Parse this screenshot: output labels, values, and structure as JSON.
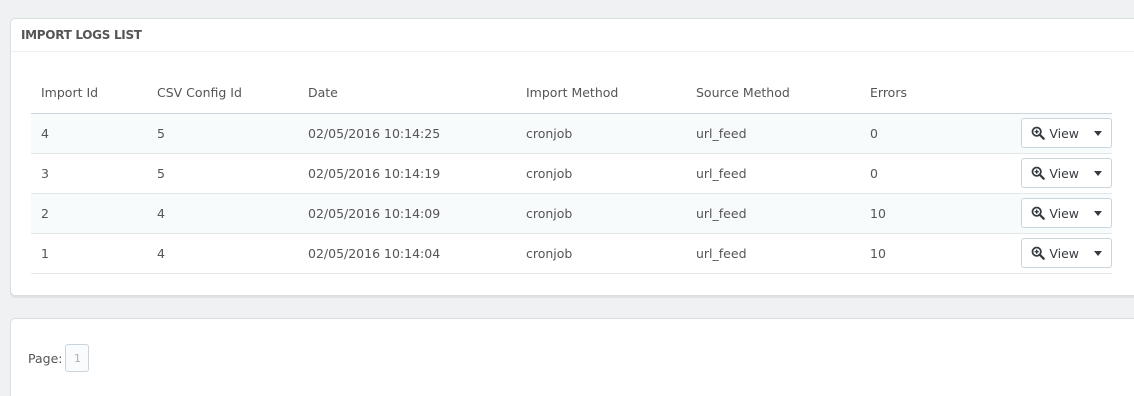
{
  "panel": {
    "title": "IMPORT LOGS LIST"
  },
  "table": {
    "headers": [
      "Import Id",
      "CSV Config Id",
      "Date",
      "Import Method",
      "Source Method",
      "Errors"
    ],
    "rows": [
      {
        "import_id": "4",
        "csv_config_id": "5",
        "date": "02/05/2016 10:14:25",
        "import_method": "cronjob",
        "source_method": "url_feed",
        "errors": "0",
        "action_label": "View"
      },
      {
        "import_id": "3",
        "csv_config_id": "5",
        "date": "02/05/2016 10:14:19",
        "import_method": "cronjob",
        "source_method": "url_feed",
        "errors": "0",
        "action_label": "View"
      },
      {
        "import_id": "2",
        "csv_config_id": "4",
        "date": "02/05/2016 10:14:09",
        "import_method": "cronjob",
        "source_method": "url_feed",
        "errors": "10",
        "action_label": "View"
      },
      {
        "import_id": "1",
        "csv_config_id": "4",
        "date": "02/05/2016 10:14:04",
        "import_method": "cronjob",
        "source_method": "url_feed",
        "errors": "10",
        "action_label": "View"
      }
    ],
    "action_icon": "zoom-in-icon",
    "dropdown_icon": "caret-down-icon"
  },
  "pagination": {
    "label": "Page:",
    "pages": [
      "1"
    ],
    "current": "1"
  }
}
